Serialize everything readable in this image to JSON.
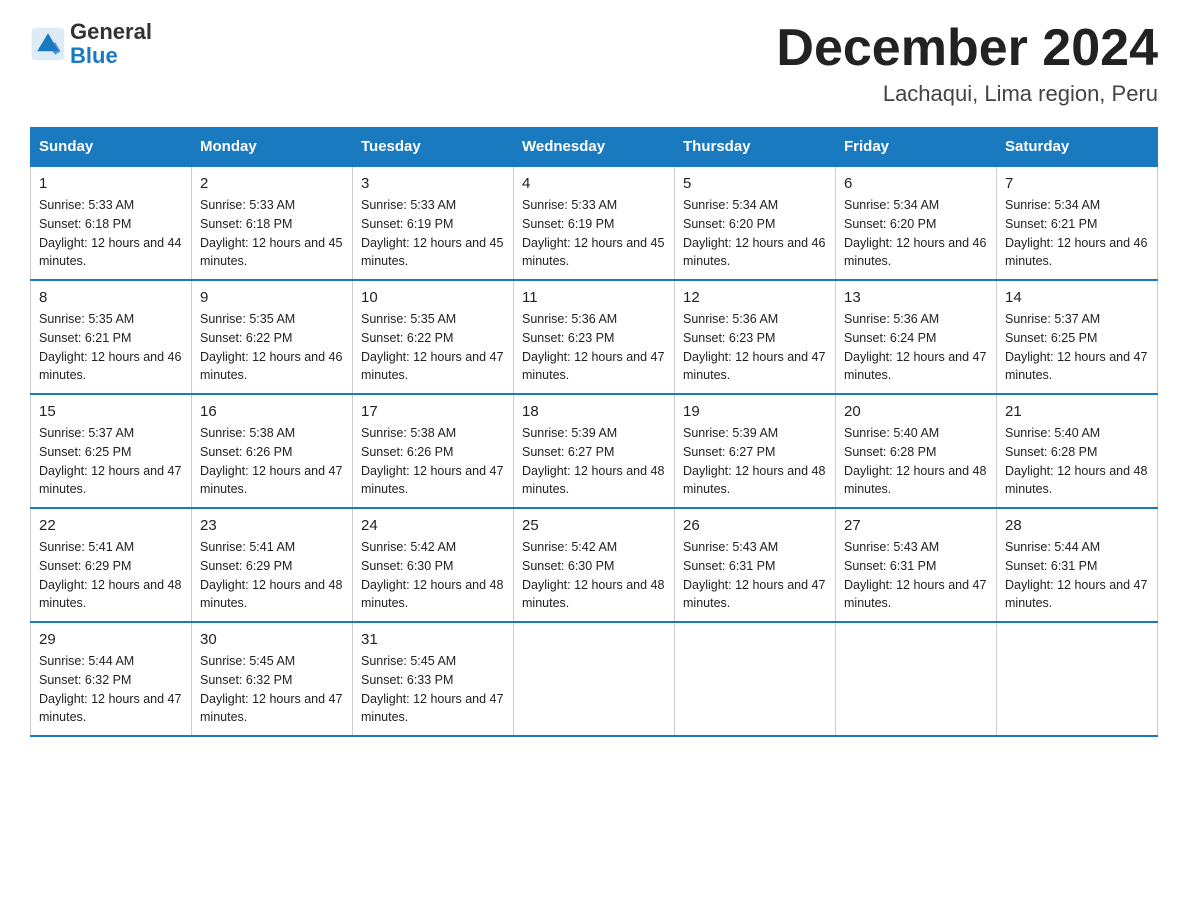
{
  "logo": {
    "general": "General",
    "blue": "Blue"
  },
  "title": "December 2024",
  "subtitle": "Lachaqui, Lima region, Peru",
  "days_header": [
    "Sunday",
    "Monday",
    "Tuesday",
    "Wednesday",
    "Thursday",
    "Friday",
    "Saturday"
  ],
  "weeks": [
    [
      {
        "day": "1",
        "sunrise": "5:33 AM",
        "sunset": "6:18 PM",
        "daylight": "12 hours and 44 minutes."
      },
      {
        "day": "2",
        "sunrise": "5:33 AM",
        "sunset": "6:18 PM",
        "daylight": "12 hours and 45 minutes."
      },
      {
        "day": "3",
        "sunrise": "5:33 AM",
        "sunset": "6:19 PM",
        "daylight": "12 hours and 45 minutes."
      },
      {
        "day": "4",
        "sunrise": "5:33 AM",
        "sunset": "6:19 PM",
        "daylight": "12 hours and 45 minutes."
      },
      {
        "day": "5",
        "sunrise": "5:34 AM",
        "sunset": "6:20 PM",
        "daylight": "12 hours and 46 minutes."
      },
      {
        "day": "6",
        "sunrise": "5:34 AM",
        "sunset": "6:20 PM",
        "daylight": "12 hours and 46 minutes."
      },
      {
        "day": "7",
        "sunrise": "5:34 AM",
        "sunset": "6:21 PM",
        "daylight": "12 hours and 46 minutes."
      }
    ],
    [
      {
        "day": "8",
        "sunrise": "5:35 AM",
        "sunset": "6:21 PM",
        "daylight": "12 hours and 46 minutes."
      },
      {
        "day": "9",
        "sunrise": "5:35 AM",
        "sunset": "6:22 PM",
        "daylight": "12 hours and 46 minutes."
      },
      {
        "day": "10",
        "sunrise": "5:35 AM",
        "sunset": "6:22 PM",
        "daylight": "12 hours and 47 minutes."
      },
      {
        "day": "11",
        "sunrise": "5:36 AM",
        "sunset": "6:23 PM",
        "daylight": "12 hours and 47 minutes."
      },
      {
        "day": "12",
        "sunrise": "5:36 AM",
        "sunset": "6:23 PM",
        "daylight": "12 hours and 47 minutes."
      },
      {
        "day": "13",
        "sunrise": "5:36 AM",
        "sunset": "6:24 PM",
        "daylight": "12 hours and 47 minutes."
      },
      {
        "day": "14",
        "sunrise": "5:37 AM",
        "sunset": "6:25 PM",
        "daylight": "12 hours and 47 minutes."
      }
    ],
    [
      {
        "day": "15",
        "sunrise": "5:37 AM",
        "sunset": "6:25 PM",
        "daylight": "12 hours and 47 minutes."
      },
      {
        "day": "16",
        "sunrise": "5:38 AM",
        "sunset": "6:26 PM",
        "daylight": "12 hours and 47 minutes."
      },
      {
        "day": "17",
        "sunrise": "5:38 AM",
        "sunset": "6:26 PM",
        "daylight": "12 hours and 47 minutes."
      },
      {
        "day": "18",
        "sunrise": "5:39 AM",
        "sunset": "6:27 PM",
        "daylight": "12 hours and 48 minutes."
      },
      {
        "day": "19",
        "sunrise": "5:39 AM",
        "sunset": "6:27 PM",
        "daylight": "12 hours and 48 minutes."
      },
      {
        "day": "20",
        "sunrise": "5:40 AM",
        "sunset": "6:28 PM",
        "daylight": "12 hours and 48 minutes."
      },
      {
        "day": "21",
        "sunrise": "5:40 AM",
        "sunset": "6:28 PM",
        "daylight": "12 hours and 48 minutes."
      }
    ],
    [
      {
        "day": "22",
        "sunrise": "5:41 AM",
        "sunset": "6:29 PM",
        "daylight": "12 hours and 48 minutes."
      },
      {
        "day": "23",
        "sunrise": "5:41 AM",
        "sunset": "6:29 PM",
        "daylight": "12 hours and 48 minutes."
      },
      {
        "day": "24",
        "sunrise": "5:42 AM",
        "sunset": "6:30 PM",
        "daylight": "12 hours and 48 minutes."
      },
      {
        "day": "25",
        "sunrise": "5:42 AM",
        "sunset": "6:30 PM",
        "daylight": "12 hours and 48 minutes."
      },
      {
        "day": "26",
        "sunrise": "5:43 AM",
        "sunset": "6:31 PM",
        "daylight": "12 hours and 47 minutes."
      },
      {
        "day": "27",
        "sunrise": "5:43 AM",
        "sunset": "6:31 PM",
        "daylight": "12 hours and 47 minutes."
      },
      {
        "day": "28",
        "sunrise": "5:44 AM",
        "sunset": "6:31 PM",
        "daylight": "12 hours and 47 minutes."
      }
    ],
    [
      {
        "day": "29",
        "sunrise": "5:44 AM",
        "sunset": "6:32 PM",
        "daylight": "12 hours and 47 minutes."
      },
      {
        "day": "30",
        "sunrise": "5:45 AM",
        "sunset": "6:32 PM",
        "daylight": "12 hours and 47 minutes."
      },
      {
        "day": "31",
        "sunrise": "5:45 AM",
        "sunset": "6:33 PM",
        "daylight": "12 hours and 47 minutes."
      },
      null,
      null,
      null,
      null
    ]
  ]
}
